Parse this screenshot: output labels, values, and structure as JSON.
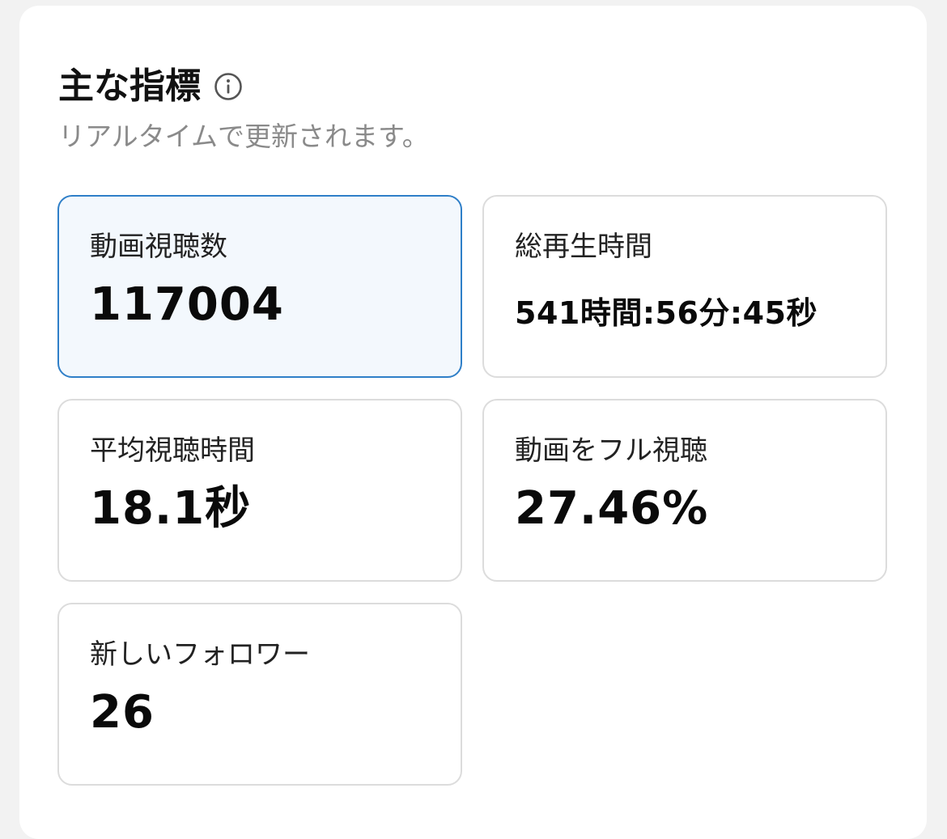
{
  "header": {
    "title": "主な指標",
    "subtitle": "リアルタイムで更新されます。",
    "info_icon": "info-icon"
  },
  "metrics": [
    {
      "label": "動画視聴数",
      "value": "117004",
      "selected": true
    },
    {
      "label": "総再生時間",
      "value": "541時間:56分:45秒",
      "selected": false
    },
    {
      "label": "平均視聴時間",
      "value": "18.1秒",
      "selected": false
    },
    {
      "label": "動画をフル視聴",
      "value": "27.46%",
      "selected": false
    },
    {
      "label": "新しいフォロワー",
      "value": "26",
      "selected": false
    }
  ],
  "colors": {
    "selected_border": "#2f7fc8",
    "selected_background": "#f3f8fd",
    "card_border": "#dcdcdc",
    "subtitle": "#8a8a8a"
  }
}
